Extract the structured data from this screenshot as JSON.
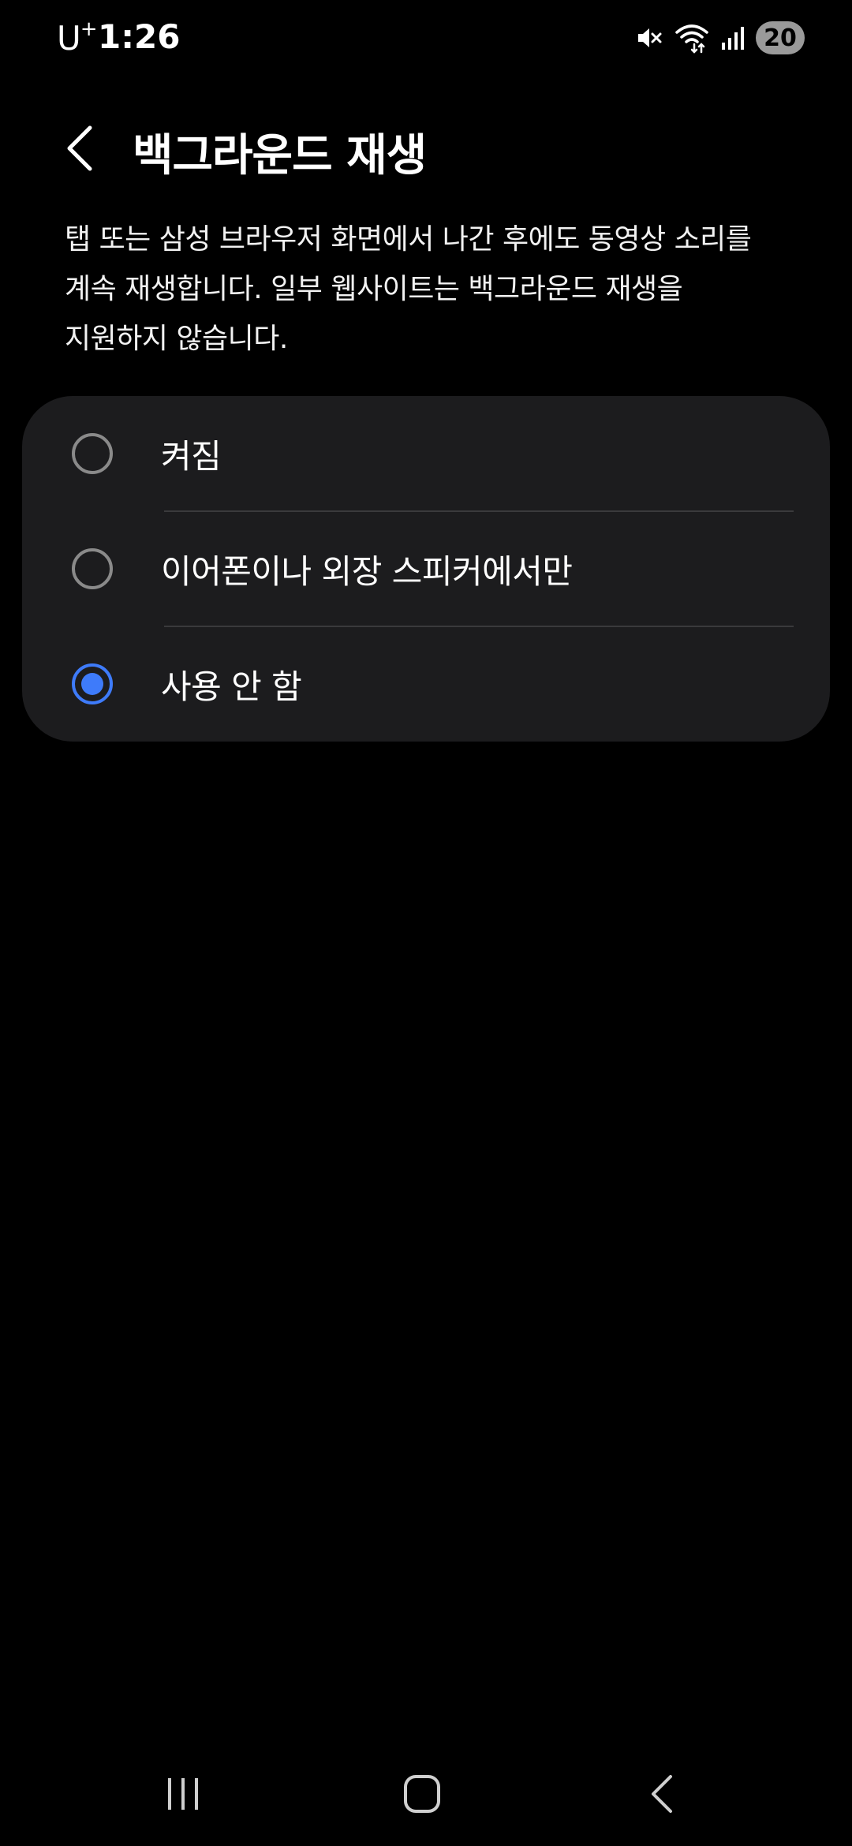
{
  "status_bar": {
    "carrier": "U",
    "carrier_sup": "+",
    "time": "1:26",
    "battery": "20",
    "icons": [
      "mute-icon",
      "wifi-icon",
      "signal-icon",
      "battery-icon"
    ]
  },
  "header": {
    "back_icon": "chevron-left-icon",
    "title": "백그라운드 재생"
  },
  "description": {
    "line1": "탭 또는 삼성 브라우저 화면에서 나간 후에도 동영상 소리를",
    "line2": "계속 재생합니다. 일부 웹사이트는 백그라운드 재생을",
    "line3": "지원하지 않습니다."
  },
  "options": [
    {
      "label": "켜짐",
      "selected": false
    },
    {
      "label": "이어폰이나 외장 스피커에서만",
      "selected": false
    },
    {
      "label": "사용 안 함",
      "selected": true
    }
  ],
  "colors": {
    "accent": "#3e7bfa",
    "card_bg": "#1c1c1e",
    "background": "#000000"
  },
  "nav_bar": {
    "icons": [
      "recents-icon",
      "home-icon",
      "back-icon"
    ]
  }
}
